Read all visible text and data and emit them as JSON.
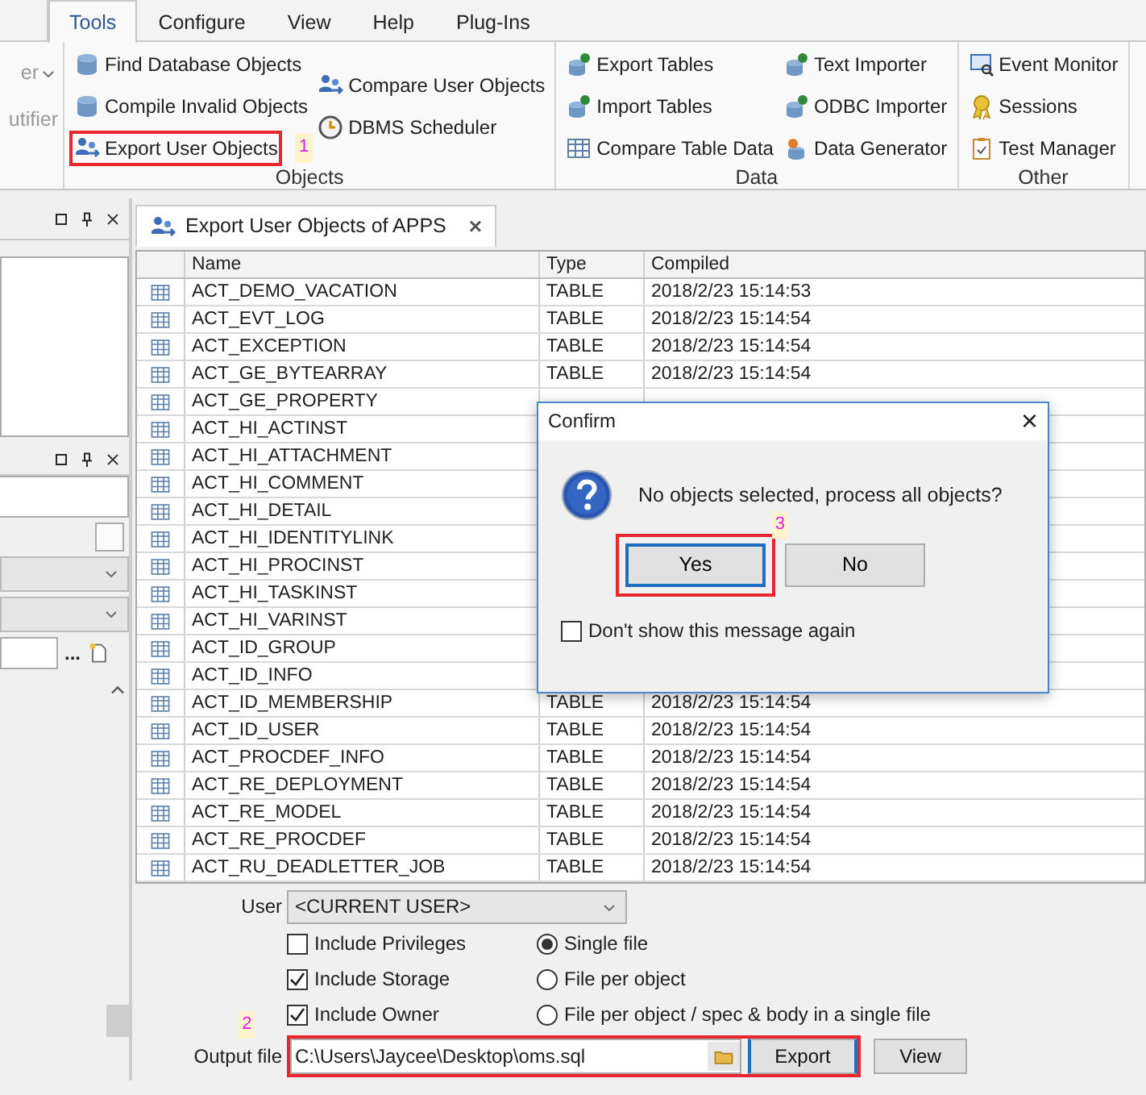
{
  "menu_tabs": [
    {
      "label": "Tools",
      "selected": true
    },
    {
      "label": "Configure",
      "selected": false
    },
    {
      "label": "View",
      "selected": false
    },
    {
      "label": "Help",
      "selected": false
    },
    {
      "label": "Plug-Ins",
      "selected": false
    }
  ],
  "ribbon": {
    "cut_group": {
      "items": [
        "er",
        "utifier"
      ]
    },
    "groups": [
      {
        "label": "Objects",
        "columns": [
          [
            {
              "label": "Find Database Objects",
              "highlighted": false
            },
            {
              "label": "Compile Invalid Objects",
              "highlighted": false
            },
            {
              "label": "Export User Objects",
              "highlighted": true,
              "marker": "1"
            }
          ],
          [
            {
              "label": "Compare User Objects",
              "highlighted": false
            },
            {
              "label": "DBMS Scheduler",
              "highlighted": false
            }
          ]
        ]
      },
      {
        "label": "Data",
        "columns": [
          [
            {
              "label": "Export Tables",
              "highlighted": false
            },
            {
              "label": "Import Tables",
              "highlighted": false
            },
            {
              "label": "Compare Table Data",
              "highlighted": false
            }
          ],
          [
            {
              "label": "Text Importer",
              "highlighted": false
            },
            {
              "label": "ODBC Importer",
              "highlighted": false
            },
            {
              "label": "Data Generator",
              "highlighted": false
            }
          ]
        ]
      },
      {
        "label": "Other",
        "columns": [
          [
            {
              "label": "Event Monitor",
              "highlighted": false
            },
            {
              "label": "Sessions",
              "highlighted": false
            },
            {
              "label": "Test Manager",
              "highlighted": false
            }
          ]
        ]
      }
    ]
  },
  "left_panel": {
    "checkbox": {
      "checked": false
    },
    "browse_button": "..."
  },
  "document_tab": {
    "label": "Export User Objects of APPS",
    "close": "×"
  },
  "table": {
    "columns": [
      "Name",
      "Type",
      "Compiled"
    ],
    "rows": [
      {
        "name": "ACT_DEMO_VACATION",
        "type": "TABLE",
        "compiled": "2018/2/23 15:14:53"
      },
      {
        "name": "ACT_EVT_LOG",
        "type": "TABLE",
        "compiled": "2018/2/23 15:14:54"
      },
      {
        "name": "ACT_EXCEPTION",
        "type": "TABLE",
        "compiled": "2018/2/23 15:14:54"
      },
      {
        "name": "ACT_GE_BYTEARRAY",
        "type": "TABLE",
        "compiled": "2018/2/23 15:14:54"
      },
      {
        "name": "ACT_GE_PROPERTY"
      },
      {
        "name": "ACT_HI_ACTINST"
      },
      {
        "name": "ACT_HI_ATTACHMENT"
      },
      {
        "name": "ACT_HI_COMMENT"
      },
      {
        "name": "ACT_HI_DETAIL"
      },
      {
        "name": "ACT_HI_IDENTITYLINK"
      },
      {
        "name": "ACT_HI_PROCINST"
      },
      {
        "name": "ACT_HI_TASKINST"
      },
      {
        "name": "ACT_HI_VARINST"
      },
      {
        "name": "ACT_ID_GROUP"
      },
      {
        "name": "ACT_ID_INFO"
      },
      {
        "name": "ACT_ID_MEMBERSHIP",
        "type": "TABLE",
        "compiled": "2018/2/23 15:14:54"
      },
      {
        "name": "ACT_ID_USER",
        "type": "TABLE",
        "compiled": "2018/2/23 15:14:54"
      },
      {
        "name": "ACT_PROCDEF_INFO",
        "type": "TABLE",
        "compiled": "2018/2/23 15:14:54"
      },
      {
        "name": "ACT_RE_DEPLOYMENT",
        "type": "TABLE",
        "compiled": "2018/2/23 15:14:54"
      },
      {
        "name": "ACT_RE_MODEL",
        "type": "TABLE",
        "compiled": "2018/2/23 15:14:54"
      },
      {
        "name": "ACT_RE_PROCDEF",
        "type": "TABLE",
        "compiled": "2018/2/23 15:14:54"
      },
      {
        "name": "ACT_RU_DEADLETTER_JOB",
        "type": "TABLE",
        "compiled": "2018/2/23 15:14:54"
      }
    ]
  },
  "options": {
    "user_label": "User",
    "user_value": "<CURRENT USER>",
    "checkboxes": [
      {
        "label": "Include Privileges",
        "checked": false
      },
      {
        "label": "Include Storage",
        "checked": true
      },
      {
        "label": "Include Owner",
        "checked": true
      }
    ],
    "radios": [
      {
        "label": "Single file",
        "selected": true
      },
      {
        "label": "File per object",
        "selected": false
      },
      {
        "label": "File per object / spec & body in a single file",
        "selected": false
      }
    ],
    "output_label": "Output file",
    "output_value": "C:\\Users\\Jaycee\\Desktop\\oms.sql",
    "highlighted": true,
    "marker": "2",
    "buttons": [
      "Export",
      "View"
    ]
  },
  "dialog": {
    "title": "Confirm",
    "close": "×",
    "message": "No objects selected, process all objects?",
    "buttons": [
      {
        "label": "Yes",
        "default": true,
        "highlighted": true,
        "marker": "3"
      },
      {
        "label": "No",
        "default": false,
        "highlighted": false
      }
    ],
    "checkbox": {
      "label": "Don't show this message again",
      "checked": false
    }
  }
}
